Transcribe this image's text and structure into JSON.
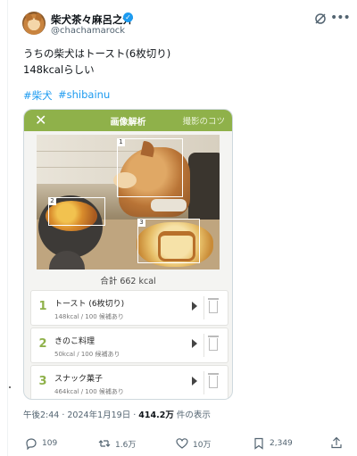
{
  "author": {
    "name": "柴犬茶々麻呂之介",
    "handle": "@chachamarock"
  },
  "tweet": {
    "line1": "うちの柴犬はトースト(6枚切り)",
    "line2": "148kcalらしい",
    "hashtags": [
      "#柴犬",
      "#shibainu"
    ]
  },
  "app_card": {
    "header_title": "画像解析",
    "header_tips": "撮影のコツ",
    "close_symbol": "✕",
    "detections": [
      "1",
      "2",
      "3"
    ],
    "total": "合計 662 kcal",
    "items": [
      {
        "num": "1",
        "name": "トースト (6枚切り)",
        "sub": "148kcal / 100 候補あり"
      },
      {
        "num": "2",
        "name": "きのこ料理",
        "sub": "50kcal / 100 候補あり"
      },
      {
        "num": "3",
        "name": "スナック菓子",
        "sub": "464kcal / 100 候補あり"
      }
    ],
    "accent_color": "#8fb14a"
  },
  "meta": {
    "time": "午後2:44 · 2024年1月19日 · ",
    "views": "414.2万",
    "views_suffix": " 件の表示"
  },
  "actions": {
    "replies": "109",
    "reposts": "1.6万",
    "likes": "10万",
    "bookmarks": "2,349"
  },
  "colors": {
    "link": "#1d9bf0",
    "verified": "#1d9bf0",
    "muted": "#536471"
  }
}
